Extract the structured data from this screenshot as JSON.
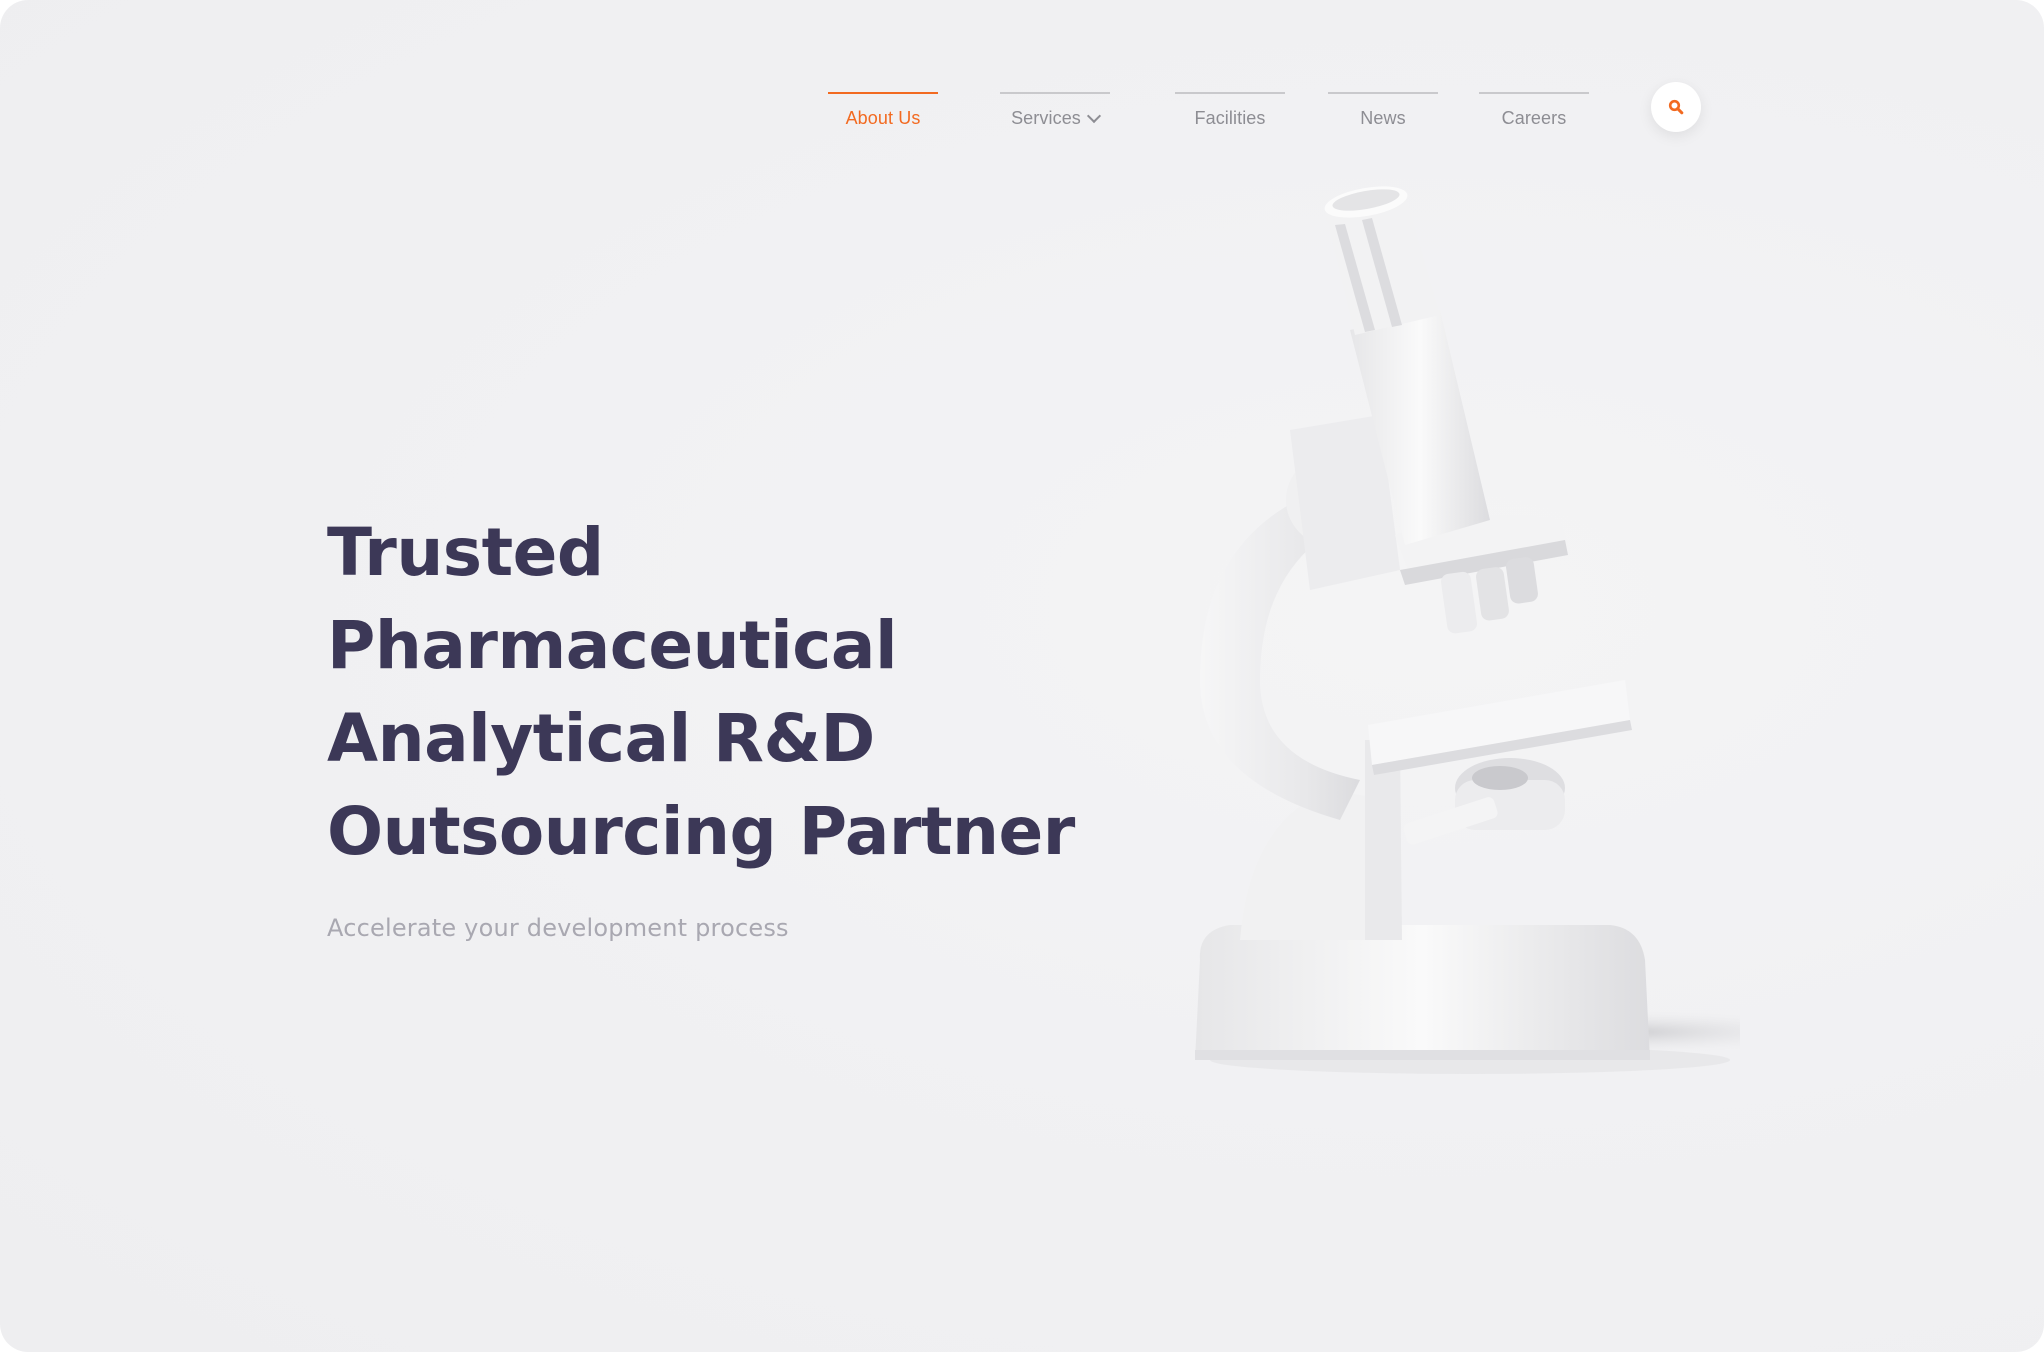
{
  "nav": {
    "items": [
      {
        "label": "About Us",
        "active": true
      },
      {
        "label": "Services",
        "has_dropdown": true
      },
      {
        "label": "Facilities"
      },
      {
        "label": "News"
      },
      {
        "label": "Careers"
      }
    ],
    "search_icon": "search-icon"
  },
  "hero": {
    "title_lines": [
      "Trusted",
      "Pharmaceutical",
      "Analytical R&D",
      "Outsourcing Partner"
    ],
    "subtitle": "Accelerate your development process",
    "image": "microscope-illustration"
  },
  "colors": {
    "accent": "#f26a21",
    "title": "#3c3857",
    "subtitle": "#a9a8b1",
    "nav_text": "#8d8d93",
    "background": "#f1f1f3"
  }
}
